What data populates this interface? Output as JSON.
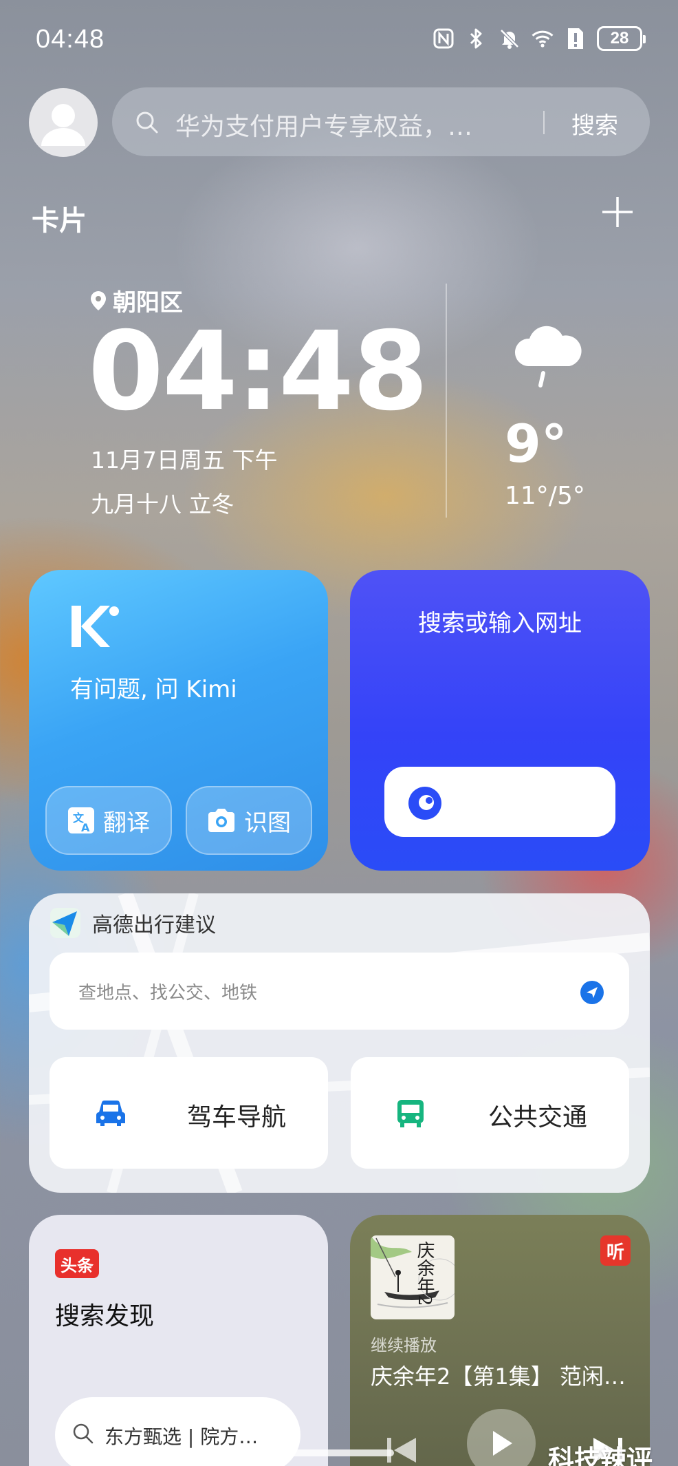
{
  "status_bar": {
    "time": "04:48",
    "battery": "28",
    "icons": [
      "nfc-icon",
      "bluetooth-icon",
      "mute-bell-icon",
      "wifi-icon",
      "sim-alert-icon",
      "battery-icon"
    ]
  },
  "search": {
    "placeholder": "华为支付用户专享权益，…",
    "button": "搜索"
  },
  "section": {
    "title": "卡片"
  },
  "clock_weather": {
    "location": "朝阳区",
    "time": "04:48",
    "date": "11月7日周五 下午",
    "lunar": "九月十八 立冬",
    "temperature": "9°",
    "range": "11°/5°",
    "weather_icon": "cloud-drizzle-icon"
  },
  "kimi": {
    "prompt": "有问题, 问 Kimi",
    "translate": "翻译",
    "recognize": "识图"
  },
  "browser": {
    "title": "搜索或输入网址"
  },
  "amap": {
    "title": "高德出行建议",
    "search_placeholder": "查地点、找公交、地铁",
    "drive": "驾车导航",
    "transit": "公共交通"
  },
  "toutiao": {
    "badge": "头条",
    "title": "搜索发现",
    "search_text": "东方甄选 | 院方…"
  },
  "audio": {
    "badge": "听",
    "continue": "继续播放",
    "track": "庆余年2【第1集】 范闲…",
    "album_text": "庆余年2"
  },
  "watermark": "科技辣评",
  "colors": {
    "kimi_blue": "#3aa4f5",
    "browser_blue": "#3443f8",
    "amap_blue": "#1a73e8",
    "transit_green": "#16b57f",
    "toutiao_red": "#e8302c"
  }
}
